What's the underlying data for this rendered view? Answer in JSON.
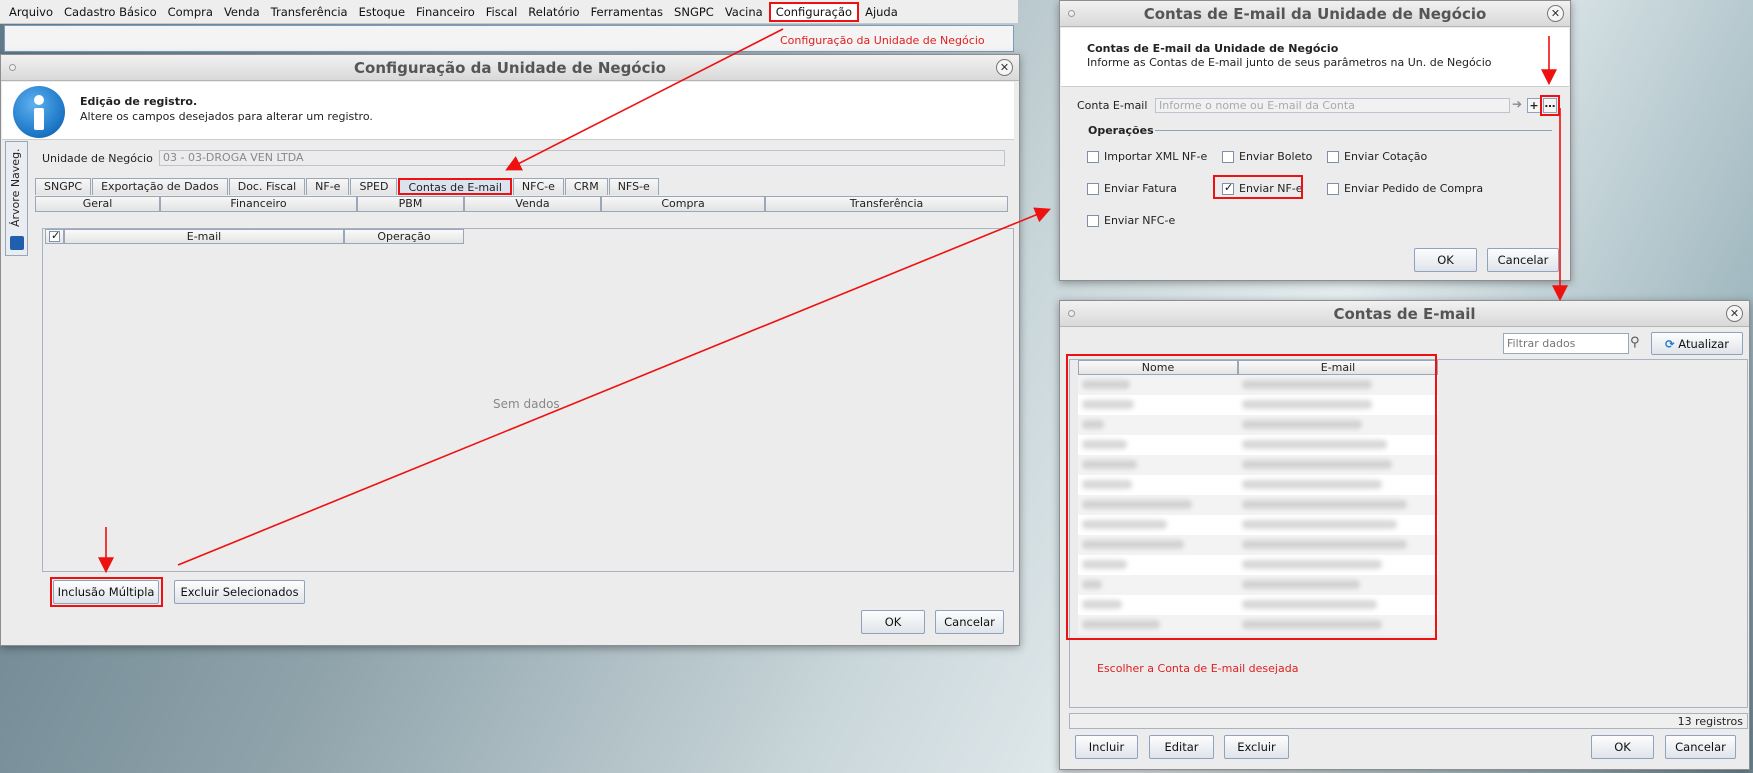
{
  "menu": {
    "items": [
      "Arquivo",
      "Cadastro Básico",
      "Compra",
      "Venda",
      "Transferência",
      "Estoque",
      "Financeiro",
      "Fiscal",
      "Relatório",
      "Ferramentas",
      "SNGPC",
      "Vacina",
      "Configuração",
      "Ajuda"
    ]
  },
  "annotations": {
    "config_link": "Configuração da Unidade de Negócio",
    "choose_account": "Escolher a Conta de E-mail desejada"
  },
  "main_window": {
    "title": "Configuração da Unidade de Negócio",
    "header_title": "Edição de registro.",
    "header_subtitle": "Altere os campos desejados para alterar um registro.",
    "side_tab": "Árvore Naveg.",
    "unit_label": "Unidade de Negócio",
    "unit_value": "03 - 03-DROGA VEN LTDA",
    "tabs": [
      "SNGPC",
      "Exportação de Dados",
      "Doc. Fiscal",
      "NF-e",
      "SPED",
      "Contas de E-mail",
      "NFC-e",
      "CRM",
      "NFS-e"
    ],
    "active_tab": "Contas de E-mail",
    "subtabs": [
      "Geral",
      "Financeiro",
      "PBM",
      "Venda",
      "Compra",
      "Transferência"
    ],
    "table_headers": [
      "E-mail",
      "Operação"
    ],
    "empty_text": "Sem dados",
    "btn_multi": "Inclusão Múltipla",
    "btn_delete": "Excluir Selecionados",
    "btn_ok": "OK",
    "btn_cancel": "Cancelar"
  },
  "email_dialog": {
    "title": "Contas de E-mail da Unidade de Negócio",
    "header_title": "Contas de E-mail da Unidade de Negócio",
    "header_subtitle": "Informe as Contas de E-mail junto de seus parâmetros na Un. de Negócio",
    "account_label": "Conta E-mail",
    "account_placeholder": "Informe o nome ou E-mail da Conta",
    "operations_label": "Operações",
    "options": [
      {
        "label": "Importar XML NF-e",
        "checked": false
      },
      {
        "label": "Enviar Boleto",
        "checked": false
      },
      {
        "label": "Enviar Cotação",
        "checked": false
      },
      {
        "label": "Enviar Fatura",
        "checked": false
      },
      {
        "label": "Enviar NF-e",
        "checked": true
      },
      {
        "label": "Enviar Pedido de Compra",
        "checked": false
      },
      {
        "label": "Enviar NFC-e",
        "checked": false
      }
    ],
    "btn_ok": "OK",
    "btn_cancel": "Cancelar"
  },
  "accounts_window": {
    "title": "Contas de E-mail",
    "filter_placeholder": "Filtrar dados",
    "btn_refresh": "Atualizar",
    "col_name": "Nome",
    "col_email": "E-mail",
    "row_count": 13,
    "footer_count": "13 registros",
    "btn_include": "Incluir",
    "btn_edit": "Editar",
    "btn_delete": "Excluir",
    "btn_ok": "OK",
    "btn_cancel": "Cancelar"
  },
  "colors": {
    "highlight": "#e11111",
    "annotation_text": "#e02020",
    "info_icon": "#1d78c8"
  },
  "icons": [
    "info-icon",
    "plus-icon",
    "ellipsis-icon",
    "search-icon",
    "refresh-icon",
    "tree-icon",
    "close-icon",
    "arrow-right-icon"
  ]
}
